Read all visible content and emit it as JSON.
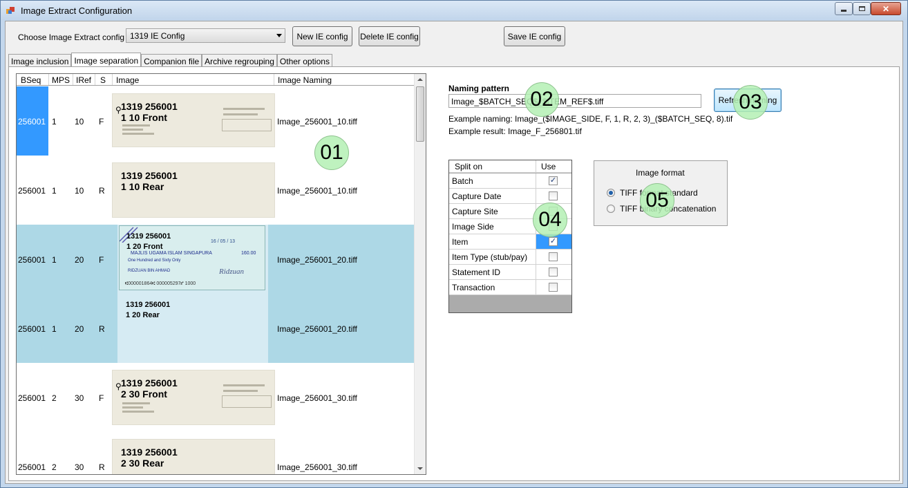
{
  "window": {
    "title": "Image Extract Configuration"
  },
  "toolbar": {
    "choose_label": "Choose Image Extract config",
    "combo_value": "1319 IE Config",
    "new_label": "New IE config",
    "delete_label": "Delete IE config",
    "save_label": "Save IE config"
  },
  "tabs": [
    {
      "label": "Image inclusion"
    },
    {
      "label": "Image separation"
    },
    {
      "label": "Companion file"
    },
    {
      "label": "Archive regrouping"
    },
    {
      "label": "Other options"
    }
  ],
  "grid": {
    "headers": {
      "bseq": "BSeq",
      "mps": "MPS",
      "iref": "IRef",
      "s": "S",
      "image": "Image",
      "naming": "Image Naming"
    },
    "rows": [
      {
        "bseq": "256001",
        "mps": "1",
        "iref": "10",
        "s": "F",
        "line1": "1319 256001",
        "line2": "1 10 Front",
        "naming": "Image_256001_10.tiff"
      },
      {
        "bseq": "256001",
        "mps": "1",
        "iref": "10",
        "s": "R",
        "line1": "1319 256001",
        "line2": "1 10 Rear",
        "naming": "Image_256001_10.tiff"
      },
      {
        "bseq": "256001",
        "mps": "1",
        "iref": "20",
        "s": "F",
        "line1": "1319 256001",
        "line2": "1 20 Front",
        "naming": "Image_256001_20.tiff"
      },
      {
        "bseq": "256001",
        "mps": "1",
        "iref": "20",
        "s": "R",
        "line1": "1319 256001",
        "line2": "1 20 Rear",
        "naming": "Image_256001_20.tiff"
      },
      {
        "bseq": "256001",
        "mps": "2",
        "iref": "30",
        "s": "F",
        "line1": "1319 256001",
        "line2": "2 30 Front",
        "naming": "Image_256001_30.tiff"
      },
      {
        "bseq": "256001",
        "mps": "2",
        "iref": "30",
        "s": "R",
        "line1": "1319 256001",
        "line2": "2 30 Rear",
        "naming": "Image_256001_30.tiff"
      }
    ],
    "cheque": {
      "date": "16 / 05 / 13",
      "payee": "MAJLIS UGAMA ISLAM SINGAPURA",
      "amount": "160.00",
      "words": "One Hundred and Sixty Only",
      "signer": "RIDZUAN BIN AHMAD",
      "signature": "Ridzuan",
      "micr": "⑆000001864⑆ 000005297⑈ 1000"
    }
  },
  "naming": {
    "label": "Naming pattern",
    "value": "Image_$BATCH_SEQ$_$ITEM_REF$.tiff",
    "example_naming": "Example naming: Image_($IMAGE_SIDE, F, 1, R, 2, 3)_($BATCH_SEQ, 8).tif",
    "example_result": "Example result: Image_F_256801.tif",
    "refresh_label": "Refresh naming"
  },
  "split": {
    "header_split": "Split on",
    "header_use": "Use",
    "rows": [
      {
        "name": "Batch",
        "checked": true
      },
      {
        "name": "Capture Date",
        "checked": false
      },
      {
        "name": "Capture Site",
        "checked": false
      },
      {
        "name": "Image Side",
        "checked": false
      },
      {
        "name": "Item",
        "checked": true
      },
      {
        "name": "Item Type (stub/pay)",
        "checked": false
      },
      {
        "name": "Statement ID",
        "checked": false
      },
      {
        "name": "Transaction",
        "checked": false
      }
    ]
  },
  "image_format": {
    "title": "Image format",
    "option1": "TIFF format standard",
    "option2": "TIFF binary concatenation",
    "selected": "TIFF format standard"
  },
  "callouts": [
    "01",
    "02",
    "03",
    "04",
    "05"
  ],
  "colors": {
    "selection": "#3399ff",
    "row_highlight": "#add8e6",
    "callout": "#b4f0b4"
  }
}
